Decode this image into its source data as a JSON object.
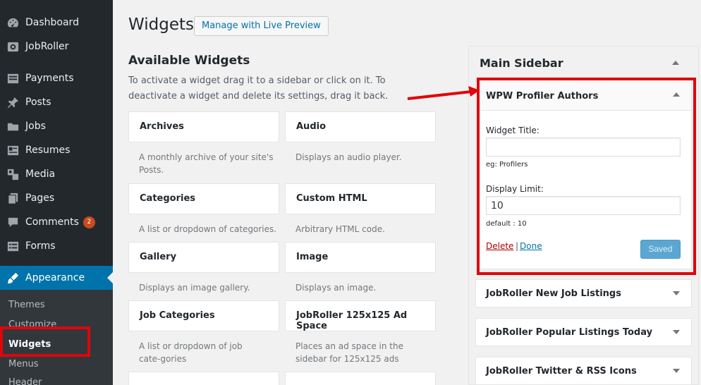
{
  "menu": {
    "items": [
      {
        "label": "Dashboard",
        "icon": "dashboard-icon"
      },
      {
        "label": "JobRoller",
        "icon": "jobroller-icon"
      },
      {
        "label": "Payments",
        "icon": "payments-icon"
      },
      {
        "label": "Posts",
        "icon": "pin-icon"
      },
      {
        "label": "Jobs",
        "icon": "folder-icon"
      },
      {
        "label": "Resumes",
        "icon": "id-card-icon"
      },
      {
        "label": "Media",
        "icon": "media-icon"
      },
      {
        "label": "Pages",
        "icon": "pages-icon"
      },
      {
        "label": "Comments",
        "icon": "comment-icon",
        "badge": "2"
      },
      {
        "label": "Forms",
        "icon": "forms-icon"
      },
      {
        "label": "Appearance",
        "icon": "brush-icon"
      }
    ],
    "submenu": [
      "Themes",
      "Customize",
      "Widgets",
      "Menus",
      "Header"
    ]
  },
  "header": {
    "title": "Widgets",
    "live_preview": "Manage with Live Preview"
  },
  "available": {
    "title": "Available Widgets",
    "description": "To activate a widget drag it to a sidebar or click on it. To deactivate a widget and delete its settings, drag it back.",
    "widgets": [
      {
        "title": "Archives",
        "desc": "A monthly archive of your site's Posts."
      },
      {
        "title": "Audio",
        "desc": "Displays an audio player."
      },
      {
        "title": "Categories",
        "desc": "A list or dropdown of categories."
      },
      {
        "title": "Custom HTML",
        "desc": "Arbitrary HTML code."
      },
      {
        "title": "Gallery",
        "desc": "Displays an image gallery."
      },
      {
        "title": "Image",
        "desc": "Displays an image."
      },
      {
        "title": "Job Categories",
        "desc": "A list or dropdown of job cate-gories"
      },
      {
        "title": "JobRoller 125x125 Ad Space",
        "desc": "Places an ad space in the sidebar for 125x125 ads"
      }
    ]
  },
  "sidebar": {
    "title": "Main Sidebar",
    "open_widget": {
      "title": "WPW Profiler Authors",
      "widget_title_label": "Widget Title:",
      "widget_title_value": "",
      "widget_title_hint": "eg: Profilers",
      "display_limit_label": "Display Limit:",
      "display_limit_value": "10",
      "display_limit_hint": "default : 10",
      "delete_label": "Delete",
      "separator": "|",
      "done_label": "Done",
      "saved_label": "Saved"
    },
    "closed_widgets": [
      "JobRoller New Job Listings",
      "JobRoller Popular Listings Today",
      "JobRoller Twitter & RSS Icons"
    ]
  },
  "colors": {
    "accent": "#0073aa",
    "highlight": "#e0050a",
    "menu_bg": "#23282d"
  }
}
